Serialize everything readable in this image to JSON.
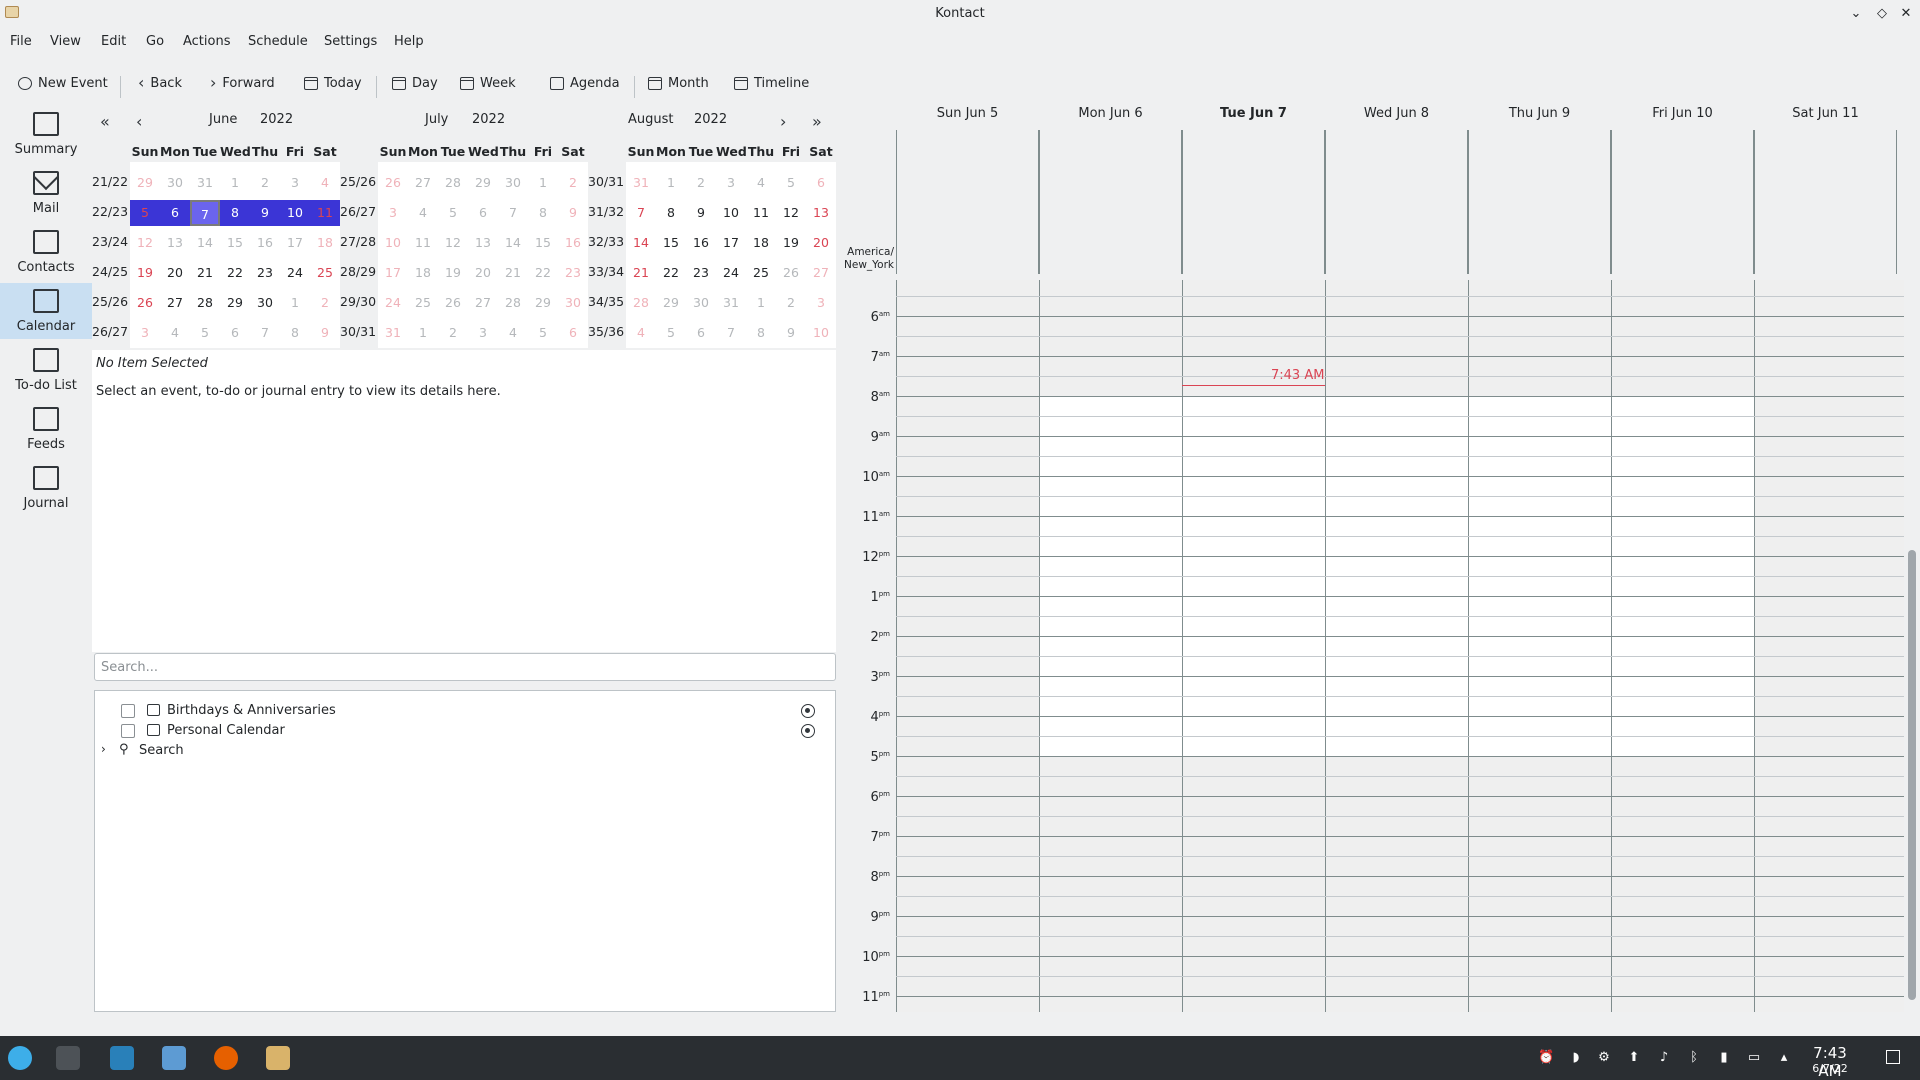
{
  "window": {
    "title": "Kontact"
  },
  "menu": [
    "File",
    "View",
    "Edit",
    "Go",
    "Actions",
    "Schedule",
    "Settings",
    "Help"
  ],
  "toolbar": {
    "new_event": "New Event",
    "back": "Back",
    "forward": "Forward",
    "today": "Today",
    "day": "Day",
    "week": "Week",
    "agenda": "Agenda",
    "month": "Month",
    "timeline": "Timeline"
  },
  "sidebar": [
    "Summary",
    "Mail",
    "Contacts",
    "Calendar",
    "To-do List",
    "Feeds",
    "Journal"
  ],
  "navigator": {
    "dow": [
      "Sun",
      "Mon",
      "Tue",
      "Wed",
      "Thu",
      "Fri",
      "Sat"
    ],
    "months": [
      {
        "name": "June",
        "year": "2022",
        "weeks": [
          "21/22",
          "22/23",
          "23/24",
          "24/25",
          "25/26",
          "26/27"
        ],
        "days": [
          [
            "29",
            "30",
            "31",
            "1",
            "2",
            "3",
            "4"
          ],
          [
            "5",
            "6",
            "7",
            "8",
            "9",
            "10",
            "11"
          ],
          [
            "12",
            "13",
            "14",
            "15",
            "16",
            "17",
            "18"
          ],
          [
            "19",
            "20",
            "21",
            "22",
            "23",
            "24",
            "25"
          ],
          [
            "26",
            "27",
            "28",
            "29",
            "30",
            "1",
            "2"
          ],
          [
            "3",
            "4",
            "5",
            "6",
            "7",
            "8",
            "9"
          ]
        ],
        "first_in_month": [
          3,
          0
        ],
        "last_in_month": [
          4,
          4
        ]
      },
      {
        "name": "July",
        "year": "2022",
        "weeks": [
          "25/26",
          "26/27",
          "27/28",
          "28/29",
          "29/30",
          "30/31"
        ],
        "days": [
          [
            "26",
            "27",
            "28",
            "29",
            "30",
            "1",
            "2"
          ],
          [
            "3",
            "4",
            "5",
            "6",
            "7",
            "8",
            "9"
          ],
          [
            "10",
            "11",
            "12",
            "13",
            "14",
            "15",
            "16"
          ],
          [
            "17",
            "18",
            "19",
            "20",
            "21",
            "22",
            "23"
          ],
          [
            "24",
            "25",
            "26",
            "27",
            "28",
            "29",
            "30"
          ],
          [
            "31",
            "1",
            "2",
            "3",
            "4",
            "5",
            "6"
          ]
        ],
        "first_in_month": [
          5,
          0
        ],
        "last_in_month": [
          0,
          5
        ]
      },
      {
        "name": "August",
        "year": "2022",
        "weeks": [
          "30/31",
          "31/32",
          "32/33",
          "33/34",
          "34/35",
          "35/36"
        ],
        "days": [
          [
            "31",
            "1",
            "2",
            "3",
            "4",
            "5",
            "6"
          ],
          [
            "7",
            "8",
            "9",
            "10",
            "11",
            "12",
            "13"
          ],
          [
            "14",
            "15",
            "16",
            "17",
            "18",
            "19",
            "20"
          ],
          [
            "21",
            "22",
            "23",
            "24",
            "25",
            "26",
            "27"
          ],
          [
            "28",
            "29",
            "30",
            "31",
            "1",
            "2",
            "3"
          ],
          [
            "4",
            "5",
            "6",
            "7",
            "8",
            "9",
            "10"
          ]
        ],
        "first_in_month": [
          1,
          0
        ],
        "last_in_month": [
          3,
          4
        ]
      }
    ]
  },
  "viewer": {
    "title": "No Item Selected",
    "hint": "Select an event, to-do or journal entry to view its details here."
  },
  "search": {
    "placeholder": "Search..."
  },
  "calendars": [
    "Birthdays & Anniversaries",
    "Personal Calendar",
    "Search"
  ],
  "week": {
    "days": [
      "Sun Jun 5",
      "Mon Jun 6",
      "Tue Jun 7",
      "Wed Jun 8",
      "Thu Jun 9",
      "Fri Jun 10",
      "Sat Jun 11"
    ],
    "today_index": 2,
    "timezone": "America/ New_York",
    "hours": [
      {
        "h": "6",
        "s": "am"
      },
      {
        "h": "7",
        "s": "am"
      },
      {
        "h": "8",
        "s": "am"
      },
      {
        "h": "9",
        "s": "am"
      },
      {
        "h": "10",
        "s": "am"
      },
      {
        "h": "11",
        "s": "am"
      },
      {
        "h": "12",
        "s": "pm"
      },
      {
        "h": "1",
        "s": "pm"
      },
      {
        "h": "2",
        "s": "pm"
      },
      {
        "h": "3",
        "s": "pm"
      },
      {
        "h": "4",
        "s": "pm"
      },
      {
        "h": "5",
        "s": "pm"
      },
      {
        "h": "6",
        "s": "pm"
      },
      {
        "h": "7",
        "s": "pm"
      },
      {
        "h": "8",
        "s": "pm"
      },
      {
        "h": "9",
        "s": "pm"
      },
      {
        "h": "10",
        "s": "pm"
      },
      {
        "h": "11",
        "s": "pm"
      }
    ],
    "now_label": "7:43 AM"
  },
  "taskbar": {
    "time": "7:43 AM",
    "date": "6/7/22"
  },
  "colors": {
    "accent": "#3b35d6",
    "weekend": "#da4453",
    "now": "#da4453",
    "taskbar": "#2a2e32"
  }
}
